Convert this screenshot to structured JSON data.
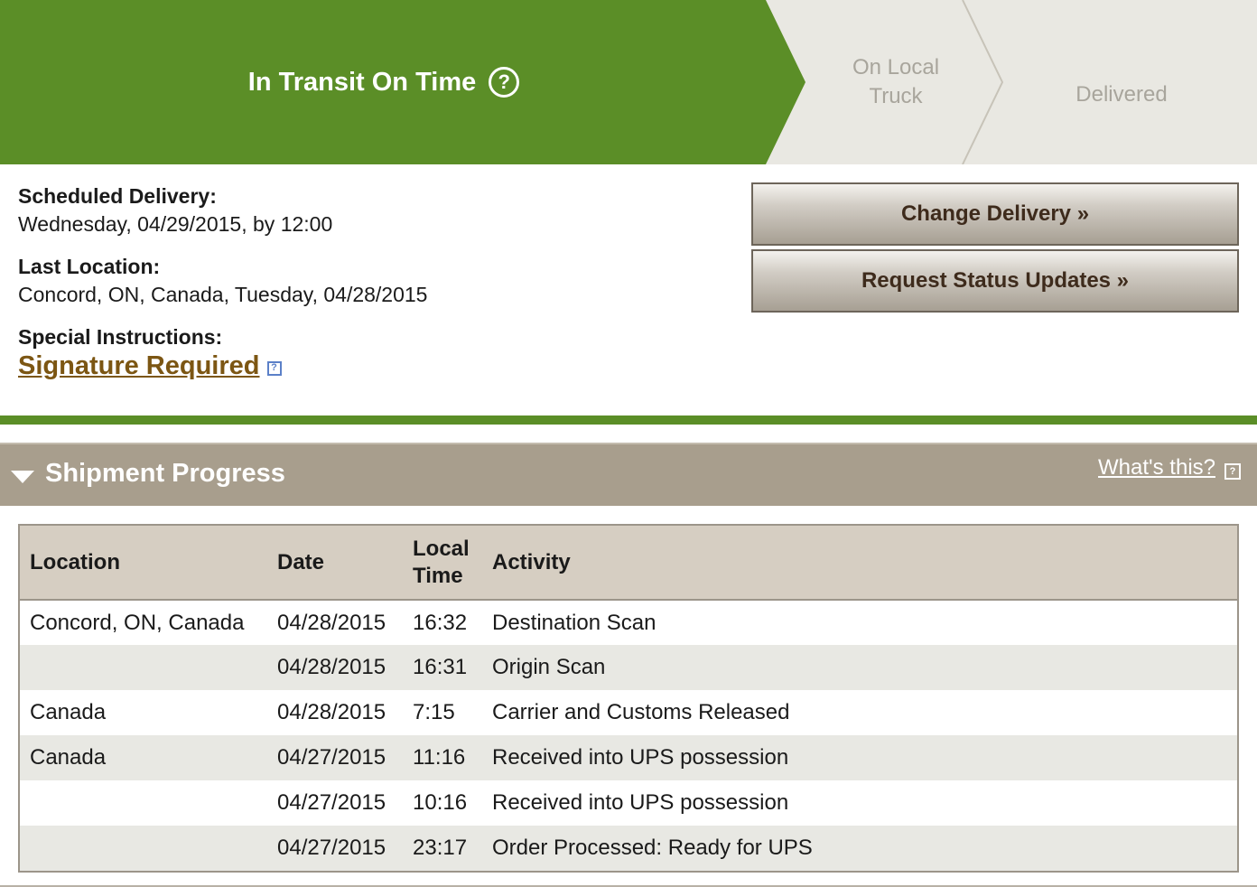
{
  "progress": {
    "current_step": "In Transit On Time",
    "help_glyph": "?",
    "steps": [
      {
        "label_line1": "On Local",
        "label_line2": "Truck"
      },
      {
        "label_line1": "Delivered"
      }
    ],
    "colors": {
      "active": "#5b8e27",
      "inactive": "#e9e8e2",
      "inactive_text": "#a8a59c"
    }
  },
  "summary": {
    "scheduled_label": "Scheduled Delivery:",
    "scheduled_value": "Wednesday, 04/29/2015, by 12:00",
    "last_location_label": "Last Location:",
    "last_location_value": "Concord, ON, Canada, Tuesday, 04/28/2015",
    "special_label": "Special Instructions:",
    "special_link": "Signature Required",
    "special_help_glyph": "?"
  },
  "actions": {
    "change_delivery": "Change Delivery »",
    "request_updates": "Request Status Updates »"
  },
  "section": {
    "title": "Shipment Progress",
    "whats_this": "What's this?",
    "help_glyph": "?"
  },
  "table": {
    "headers": {
      "location": "Location",
      "date": "Date",
      "local_time_line1": "Local",
      "local_time_line2": "Time",
      "activity": "Activity"
    },
    "rows": [
      {
        "location": "Concord, ON, Canada",
        "date": "04/28/2015",
        "time": "16:32",
        "activity": "Destination Scan"
      },
      {
        "location": "",
        "date": "04/28/2015",
        "time": "16:31",
        "activity": "Origin Scan"
      },
      {
        "location": "Canada",
        "date": "04/28/2015",
        "time": "7:15",
        "activity": "Carrier and Customs Released"
      },
      {
        "location": "Canada",
        "date": "04/27/2015",
        "time": "11:16",
        "activity": "Received into UPS possession"
      },
      {
        "location": "",
        "date": "04/27/2015",
        "time": "10:16",
        "activity": "Received into UPS possession"
      },
      {
        "location": "",
        "date": "04/27/2015",
        "time": "23:17",
        "activity": "Order Processed: Ready for UPS"
      }
    ]
  }
}
